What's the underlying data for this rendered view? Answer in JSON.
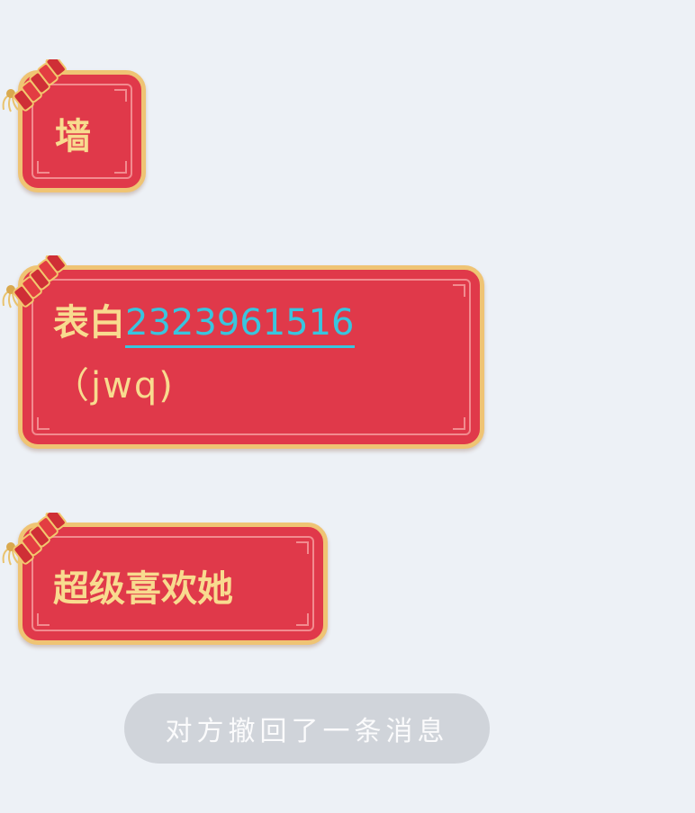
{
  "messages": [
    {
      "text": "墙"
    },
    {
      "prefix": "表白",
      "link": "2323961516",
      "suffix": "（jwq)"
    },
    {
      "text": "超级喜欢她"
    }
  ],
  "system_notice": "对方撤回了一条消息",
  "colors": {
    "background": "#edf1f6",
    "bubble_fill": "#e0394a",
    "bubble_border": "#efc474",
    "bubble_text": "#f8db8f",
    "link": "#39c5de",
    "notice_pill": "#d0d4da",
    "notice_text": "#fbfbfc"
  }
}
